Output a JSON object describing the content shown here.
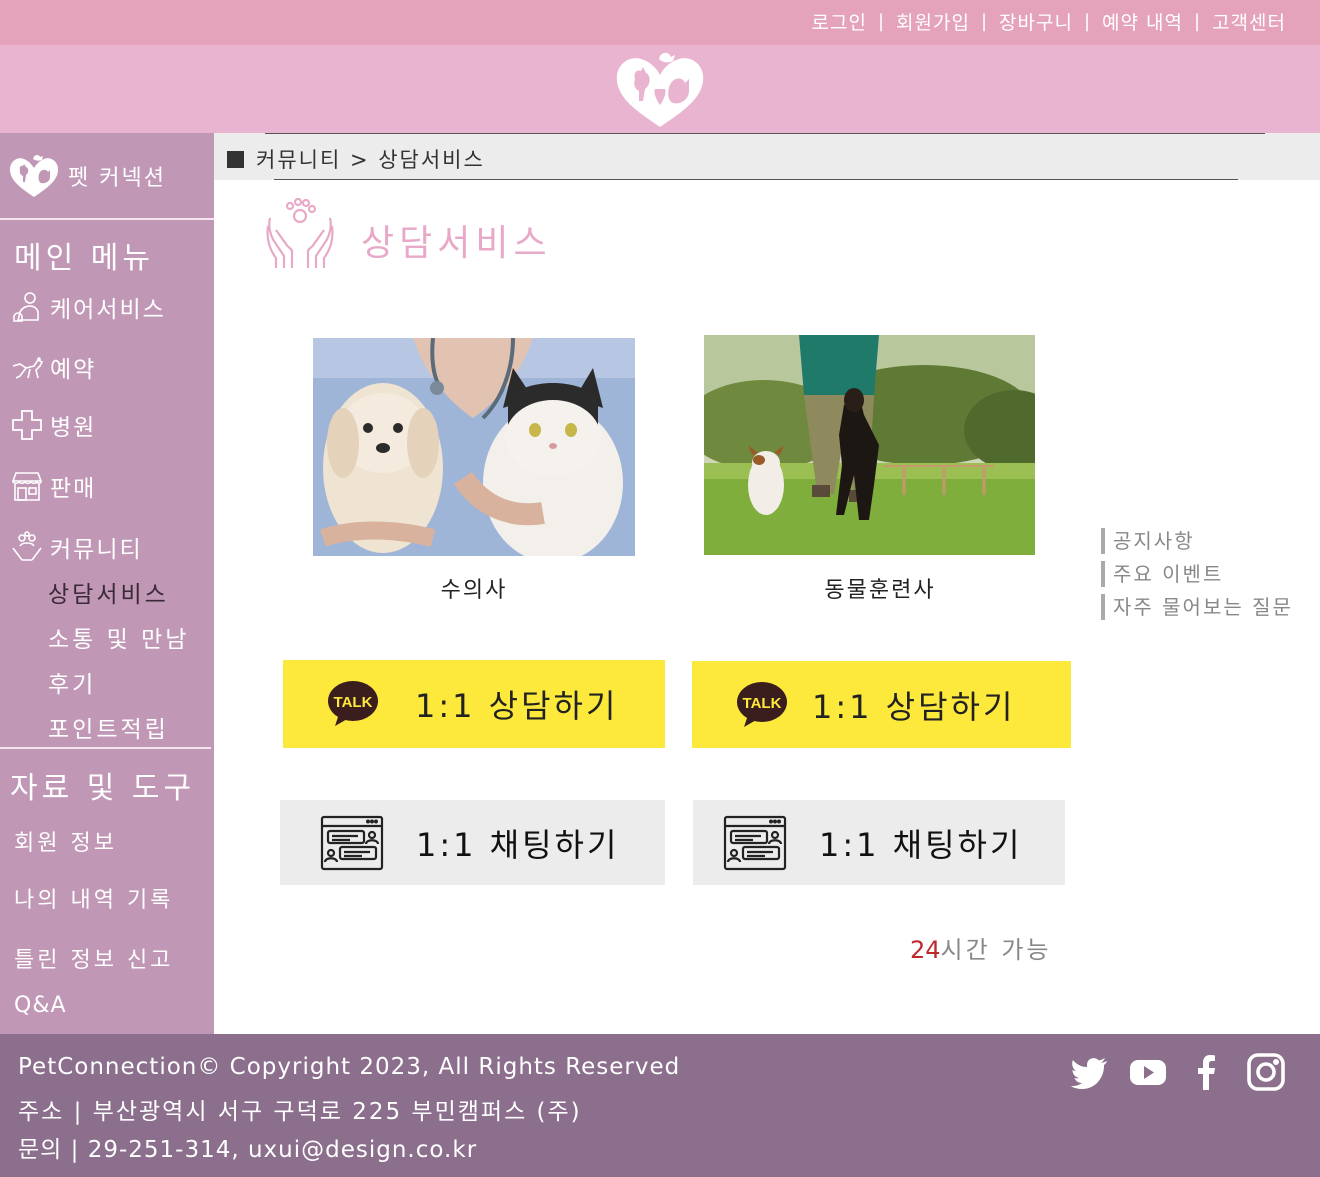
{
  "topnav": {
    "items": [
      "로그인",
      "회원가입",
      "장바구니",
      "예약 내역",
      "고객센터"
    ],
    "separator": "|"
  },
  "brand": {
    "name": "펫 커넥션"
  },
  "sidebar": {
    "main_title": "메인 메뉴",
    "items": [
      {
        "label": "케어서비스",
        "icon": "care-icon"
      },
      {
        "label": "예약",
        "icon": "dog-run-icon"
      },
      {
        "label": "병원",
        "icon": "medical-cross-icon"
      },
      {
        "label": "판매",
        "icon": "shop-icon"
      },
      {
        "label": "커뮤니티",
        "icon": "community-icon"
      }
    ],
    "sub_items": [
      "상담서비스",
      "소통 및 만남",
      "후기",
      "포인트적립"
    ],
    "active_sub": "상담서비스",
    "tools_title": "자료 및 도구",
    "tools": [
      "회원 정보",
      "나의 내역 기록",
      "틀린 정보 신고",
      "Q&A"
    ]
  },
  "breadcrumb": {
    "text": "커뮤니티 > 상담서비스"
  },
  "page": {
    "title": "상담서비스",
    "title_icon": "paw-hands-icon"
  },
  "experts": [
    {
      "caption": "수의사"
    },
    {
      "caption": "동물훈련사"
    }
  ],
  "buttons": {
    "kakao_label": "1:1 상담하기",
    "kakao_badge": "TALK",
    "chat_label": "1:1 채팅하기"
  },
  "availability": {
    "number": "24",
    "text": "시간 가능"
  },
  "side_links": [
    "공지사항",
    "주요 이벤트",
    "자주 물어보는 질문"
  ],
  "footer": {
    "copyright": "PetConnection© Copyright 2023, All Rights Reserved",
    "address": "주소 | 부산광역시 서구 구덕로 225 부민캠퍼스 (주)",
    "contact": "문의 | 29-251-314, uxui@design.co.kr",
    "social": [
      "twitter-icon",
      "youtube-icon",
      "facebook-icon",
      "instagram-icon"
    ]
  },
  "colors": {
    "topbar": "#e4a3bb",
    "header": "#e8b4cf",
    "sidebar": "#c197b6",
    "accent_pink": "#e8a9c8",
    "kakao_yellow": "#fde93b",
    "footer": "#8b6f8c",
    "highlight_red": "#c0272d"
  }
}
